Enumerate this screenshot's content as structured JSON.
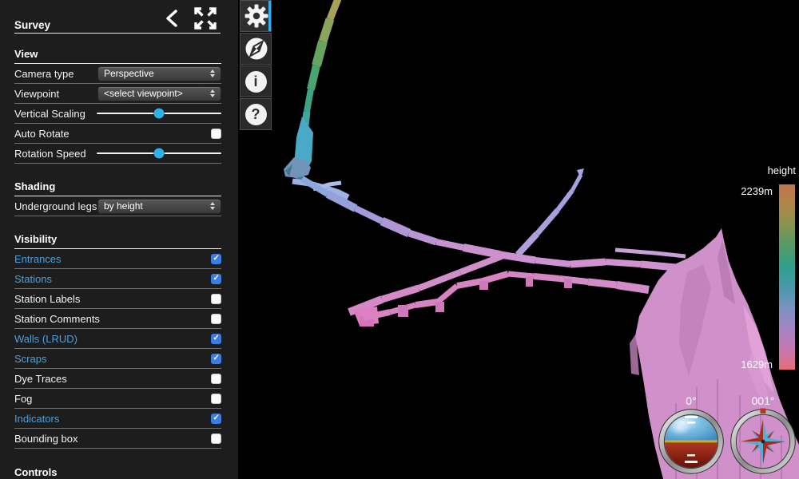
{
  "sidebar": {
    "title": "Survey",
    "view": {
      "heading": "View",
      "camera_type": {
        "label": "Camera type",
        "value": "Perspective"
      },
      "viewpoint": {
        "label": "Viewpoint",
        "value": "<select viewpoint>"
      },
      "vertical_scaling": {
        "label": "Vertical Scaling",
        "percent": 50
      },
      "auto_rotate": {
        "label": "Auto Rotate",
        "checked": false
      },
      "rotation_speed": {
        "label": "Rotation Speed",
        "percent": 50
      }
    },
    "shading": {
      "heading": "Shading",
      "underground_legs": {
        "label": "Underground legs",
        "value": "by height"
      }
    },
    "visibility": {
      "heading": "Visibility",
      "items": [
        {
          "label": "Entrances",
          "checked": true,
          "highlighted": true
        },
        {
          "label": "Stations",
          "checked": true,
          "highlighted": true
        },
        {
          "label": "Station Labels",
          "checked": false,
          "highlighted": false
        },
        {
          "label": "Station Comments",
          "checked": false,
          "highlighted": false
        },
        {
          "label": "Walls (LRUD)",
          "checked": true,
          "highlighted": true
        },
        {
          "label": "Scraps",
          "checked": true,
          "highlighted": true
        },
        {
          "label": "Dye Traces",
          "checked": false,
          "highlighted": false
        },
        {
          "label": "Fog",
          "checked": false,
          "highlighted": false
        },
        {
          "label": "Indicators",
          "checked": true,
          "highlighted": true
        },
        {
          "label": "Bounding box",
          "checked": false,
          "highlighted": false
        }
      ]
    },
    "controls": {
      "heading": "Controls"
    }
  },
  "tabs": [
    {
      "name": "settings",
      "icon": "gear-icon",
      "active": true
    },
    {
      "name": "navigation",
      "icon": "compass-icon",
      "active": false
    },
    {
      "name": "information",
      "icon": "info-icon",
      "active": false,
      "glyph": "i"
    },
    {
      "name": "help",
      "icon": "question-icon",
      "active": false,
      "glyph": "?"
    }
  ],
  "legend": {
    "title": "height",
    "max": "2239m",
    "min": "1629m",
    "gradient_stops": [
      "#c1754f",
      "#ad8748",
      "#87944f",
      "#529b66",
      "#2f9f8d",
      "#4899ab",
      "#7b92c0",
      "#a285c4",
      "#c579ae",
      "#e66c7a"
    ]
  },
  "indicators": {
    "pitch": {
      "value": "0°"
    },
    "bearing": {
      "value": "001°"
    }
  },
  "colors": {
    "accent_blue": "#3b7de0",
    "link_blue": "#4aa0dc",
    "slider_thumb": "#2fb0e8",
    "tab_active_bar": "#35aef0"
  }
}
